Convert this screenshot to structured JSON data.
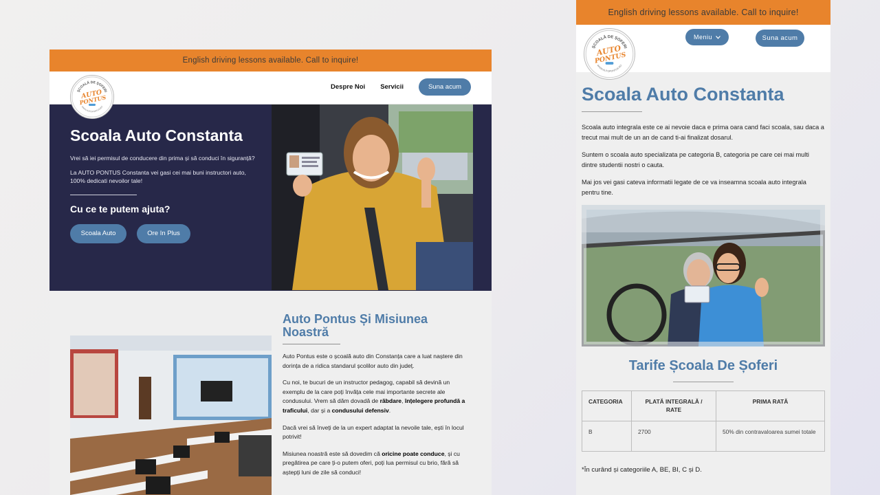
{
  "banner": {
    "text": "English driving lessons available. Call to inquire!"
  },
  "logo": {
    "top_text": "ȘCOALĂ DE ȘOFERI",
    "brand": "AUTO PONTUS",
    "bottom_text": "WWW.AUTOPONTUS.RO"
  },
  "colors": {
    "accent": "#4f7ca8",
    "banner": "#e8842c",
    "hero_bg": "#272849"
  },
  "desktop": {
    "nav": {
      "links": [
        "Despre Noi",
        "Servicii"
      ],
      "cta": "Suna acum"
    },
    "hero": {
      "title": "Scoala Auto Constanta",
      "p1": "Vrei să iei permisul de conducere din prima și să conduci în siguranță?",
      "p2": "La AUTO PONTUS Constanta vei gasi cei mai buni instructori auto, 100% dedicati nevoilor tale!",
      "subtitle": "Cu ce te putem ajuta?",
      "btn1": "Scoala Auto",
      "btn2": "Ore In Plus"
    },
    "mission": {
      "title": "Auto Pontus Și Misiunea Noastră",
      "p1": "Auto Pontus este o școală auto din Constanța care a luat naștere din dorința de a ridica standarul școlilor auto din județ.",
      "p2_a": "Cu noi, te bucuri de un instructor pedagog, capabil să devină un exemplu de la care poți învăța cele mai importante secrete ale condusului. Vrem să dăm dovadă de ",
      "p2_b1": "răbdare",
      "p2_sep1": ", ",
      "p2_b2": "înțelegere profundă a traficului",
      "p2_sep2": ", dar și a ",
      "p2_b3": "condusului defensiv",
      "p2_end": ".",
      "p3": "Dacă vrei să înveți de la un expert adaptat la nevoile tale, ești în locul potrivit!",
      "p4_a": "Misiunea noastră este să dovedim că ",
      "p4_b1": "oricine poate conduce",
      "p4_c": ", și cu pregătirea pe care ți-o putem oferi, poți lua permisul cu brio, fără să aștepți luni de zile să conduci!"
    }
  },
  "mobile": {
    "menu": "Meniu",
    "cta": "Suna acum",
    "title": "Scoala Auto Constanta",
    "p1": "Scoala auto integrala este ce ai nevoie daca e prima oara cand faci scoala, sau daca a trecut mai mult de un an de cand ti-ai finalizat dosarul.",
    "p2": "Suntem o scoala auto specializata pe categoria B, categoria pe care cei mai multi dintre studentii nostri o cauta.",
    "p3": "Mai jos vei gasi cateva informatii legate de ce va inseamna scoala auto integrala pentru tine.",
    "tarife_title": "Tarife Școala De Șoferi",
    "table": {
      "headers": [
        "CATEGORIA",
        "PLATĂ INTEGRALĂ / RATE",
        "PRIMA RATĂ"
      ],
      "rows": [
        [
          "B",
          "2700",
          "50% din contravaloarea sumei totale"
        ]
      ]
    },
    "footnote": "*În curând și categoriile A, BE, BI, C și D."
  }
}
